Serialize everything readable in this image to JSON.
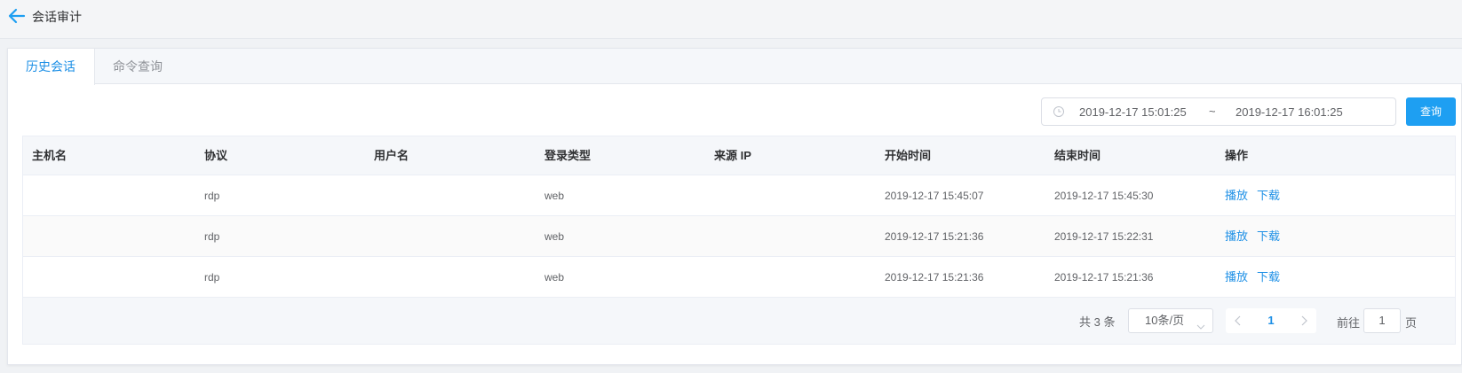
{
  "header": {
    "title": "会话审计"
  },
  "tabs": [
    {
      "label": "历史会话"
    },
    {
      "label": "命令查询"
    }
  ],
  "daterange": {
    "start": "2019-12-17 15:01:25",
    "separator": "~",
    "end": "2019-12-17 16:01:25"
  },
  "query_button": "查询",
  "table": {
    "columns": [
      "主机名",
      "协议",
      "用户名",
      "登录类型",
      "来源 IP",
      "开始时间",
      "结束时间",
      "操作"
    ],
    "rows": [
      {
        "protocol": "rdp",
        "login_type": "web",
        "start": "2019-12-17 15:45:07",
        "end": "2019-12-17 15:45:30",
        "play": "播放",
        "download": "下载"
      },
      {
        "protocol": "rdp",
        "login_type": "web",
        "start": "2019-12-17 15:21:36",
        "end": "2019-12-17 15:22:31",
        "play": "播放",
        "download": "下载"
      },
      {
        "protocol": "rdp",
        "login_type": "web",
        "start": "2019-12-17 15:21:36",
        "end": "2019-12-17 15:21:36",
        "play": "播放",
        "download": "下载"
      }
    ]
  },
  "pagination": {
    "total": "共 3 条",
    "page_size": "10条/页",
    "current_page": "1",
    "goto_label": "前往",
    "goto_value": "1",
    "goto_suffix": "页"
  },
  "colors": {
    "accent": "#1e90e6",
    "button": "#1e9ff2"
  }
}
